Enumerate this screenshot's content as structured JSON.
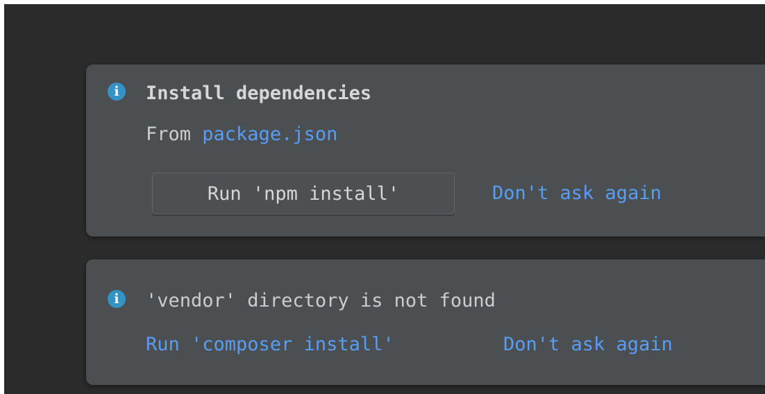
{
  "colors": {
    "background": "#2b2b2b",
    "notification_bg": "#4b4f51",
    "link": "#589df6",
    "info_icon": "#3592c4",
    "text": "#cdcdcd"
  },
  "notifications": [
    {
      "icon": "info-icon",
      "title": "Install dependencies",
      "subtitle_prefix": "From ",
      "subtitle_link": "package.json",
      "primary_action": "Run 'npm install'",
      "secondary_action": "Don't ask again"
    },
    {
      "icon": "info-icon",
      "message": "'vendor' directory is not found",
      "primary_action": "Run 'composer install'",
      "secondary_action": "Don't ask again"
    }
  ]
}
